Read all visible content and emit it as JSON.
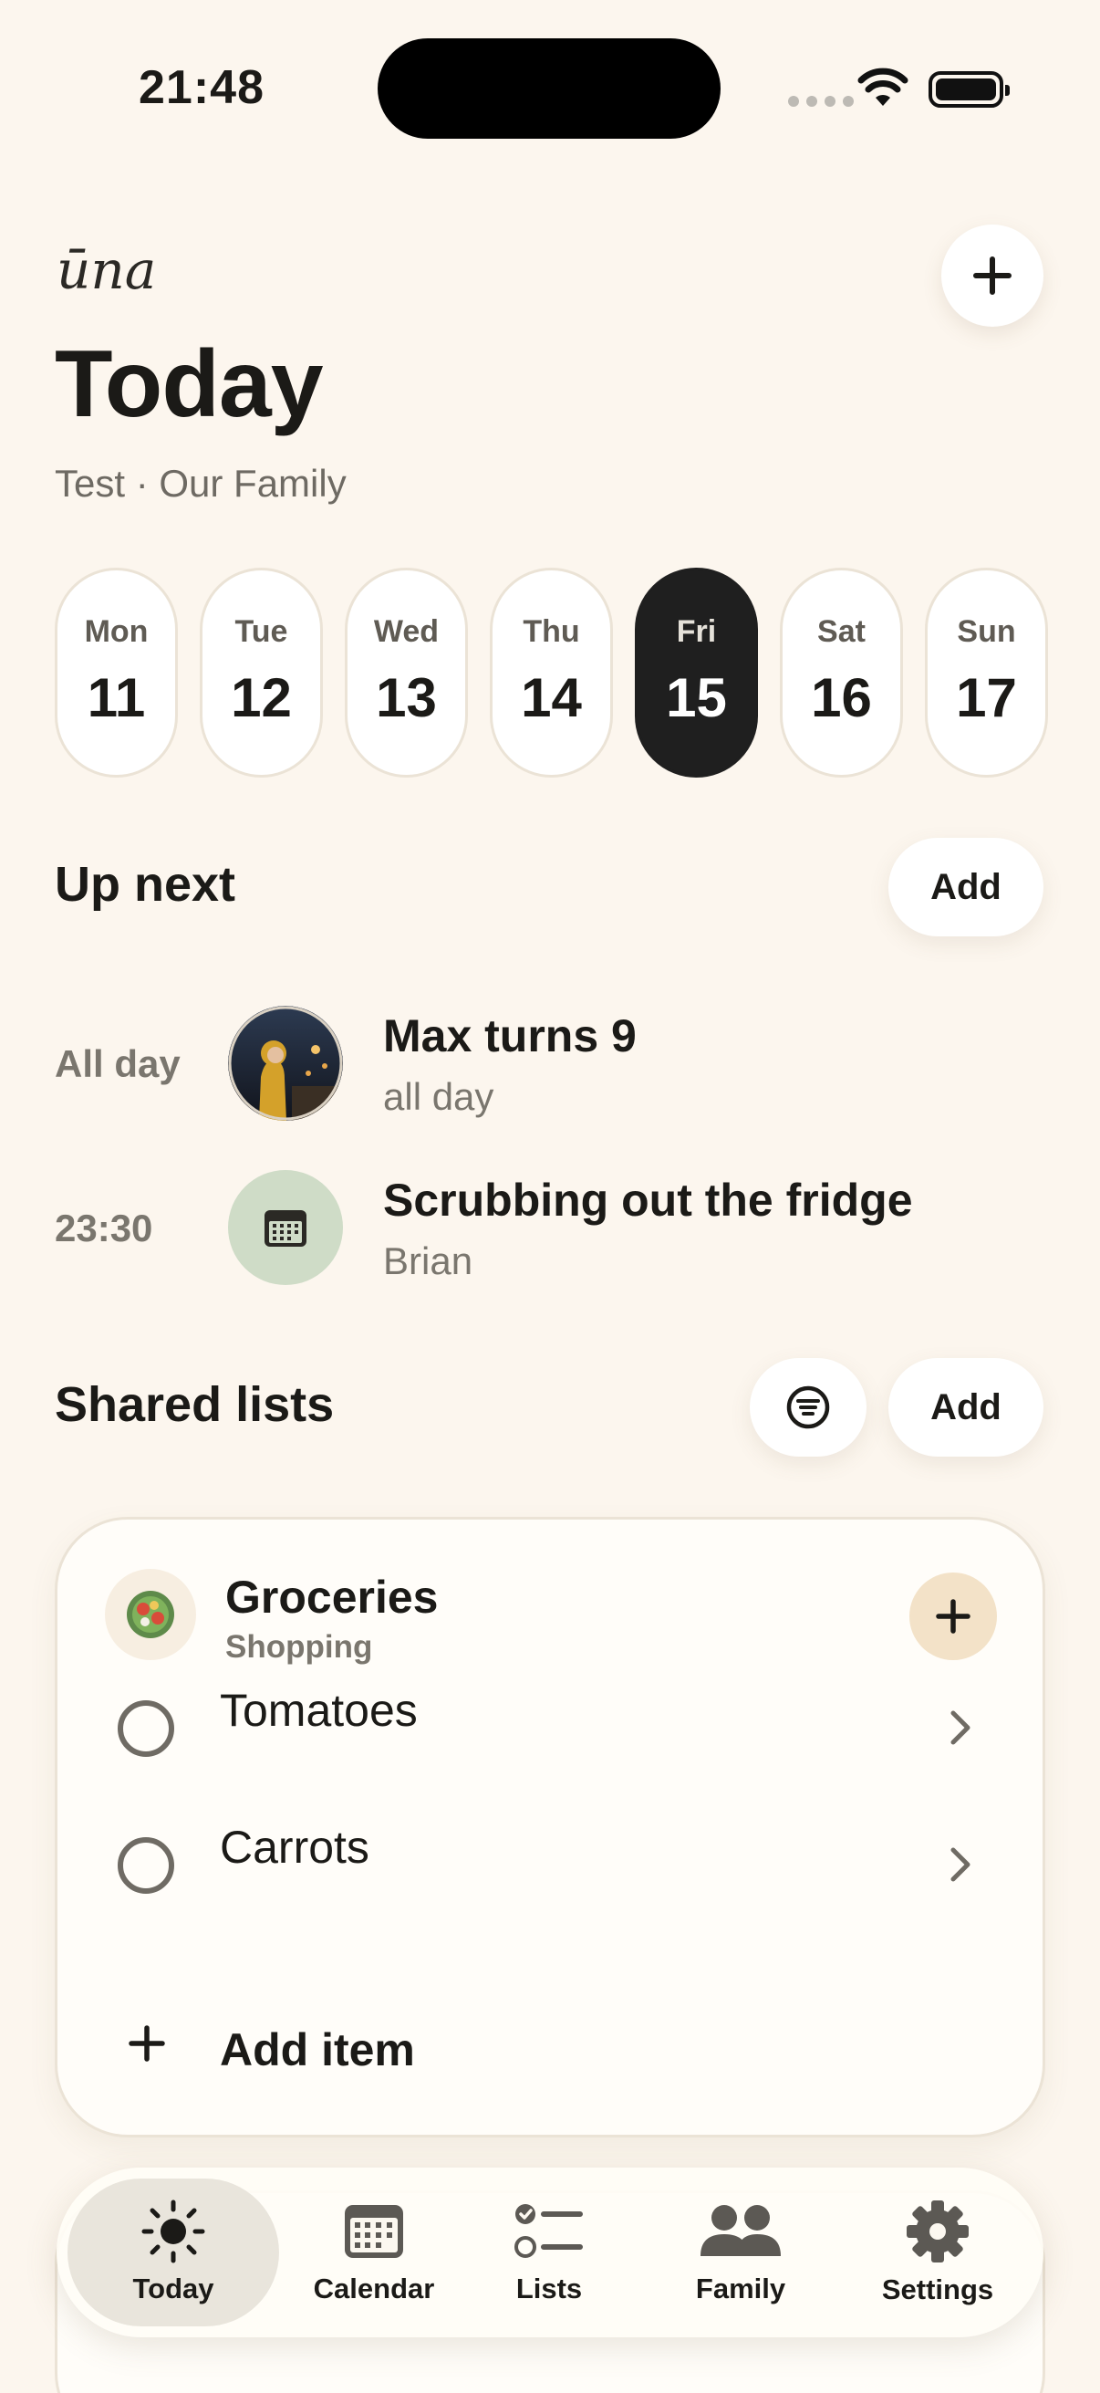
{
  "status_bar": {
    "time": "21:48"
  },
  "header": {
    "brand": "ūna",
    "title": "Today",
    "subtitle": "Test · Our Family"
  },
  "week": [
    {
      "day": "Mon",
      "date": "11",
      "active": false
    },
    {
      "day": "Tue",
      "date": "12",
      "active": false
    },
    {
      "day": "Wed",
      "date": "13",
      "active": false
    },
    {
      "day": "Thu",
      "date": "14",
      "active": false
    },
    {
      "day": "Fri",
      "date": "15",
      "active": true
    },
    {
      "day": "Sat",
      "date": "16",
      "active": false
    },
    {
      "day": "Sun",
      "date": "17",
      "active": false
    }
  ],
  "up_next": {
    "title": "Up next",
    "add_label": "Add",
    "events": [
      {
        "time": "All day",
        "title": "Max turns 9",
        "subtitle": "all day",
        "icon": "photo-avatar"
      },
      {
        "time": "23:30",
        "title": "Scrubbing out the fridge",
        "subtitle": "Brian",
        "icon": "calendar-icon"
      }
    ]
  },
  "shared_lists": {
    "title": "Shared lists",
    "add_label": "Add",
    "filter_icon": "filter-icon",
    "list": {
      "name": "Groceries",
      "category": "Shopping",
      "icon": "salad-bowl-icon",
      "items": [
        {
          "label": "Tomatoes",
          "done": false
        },
        {
          "label": "Carrots",
          "done": false
        }
      ],
      "add_item_label": "Add item"
    }
  },
  "tabbar": {
    "tabs": [
      {
        "label": "Today",
        "icon": "sun-icon",
        "active": true
      },
      {
        "label": "Calendar",
        "icon": "calendar-icon",
        "active": false
      },
      {
        "label": "Lists",
        "icon": "checklist-icon",
        "active": false
      },
      {
        "label": "Family",
        "icon": "people-icon",
        "active": false
      },
      {
        "label": "Settings",
        "icon": "gear-icon",
        "active": false
      }
    ]
  },
  "colors": {
    "background": "#fcf6ee",
    "active_day": "#1f1f1f",
    "event_icon_bg": "#cfdcc7",
    "list_plus_bg": "#f3e2c8"
  }
}
